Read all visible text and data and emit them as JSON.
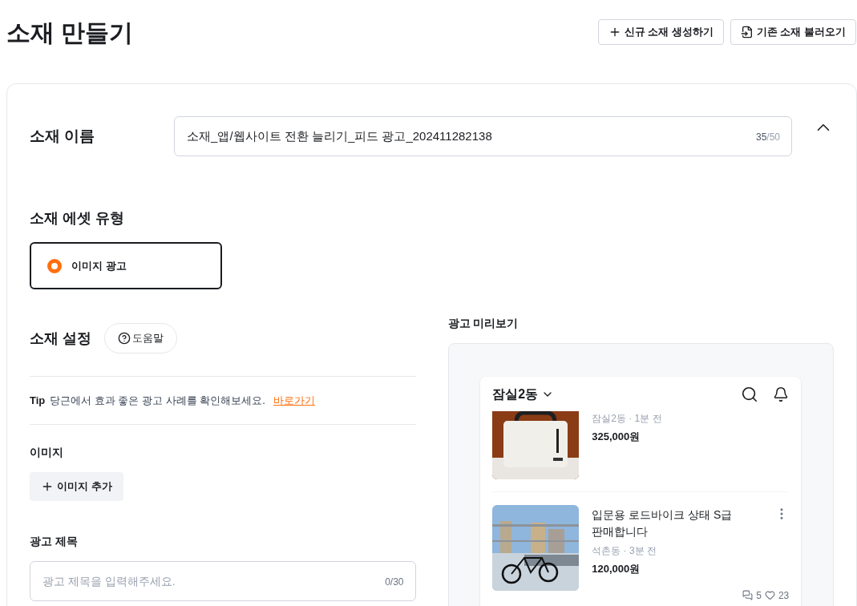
{
  "page": {
    "title": "소재 만들기",
    "actions": [
      {
        "kind": "new",
        "label": "신규 소재 생성하기"
      },
      {
        "kind": "load",
        "label": "기존 소재 불러오기"
      }
    ]
  },
  "name_section": {
    "label": "소재 이름",
    "value": "소재_앱/웹사이트 전환 늘리기_피드 광고_202411282138",
    "count": "35",
    "max": "/50",
    "expanded": true
  },
  "asset_type": {
    "label": "소재 에셋 유형",
    "options": [
      {
        "label": "이미지 광고",
        "selected": true
      }
    ]
  },
  "settings": {
    "label": "소재 설정",
    "help": "도움말",
    "tip_label": "Tip",
    "tip": "당근에서 효과 좋은 광고 사례를 확인해보세요.",
    "tip_link": "바로가기",
    "image_label": "이미지",
    "add_image": "이미지 추가",
    "title_label": "광고 제목",
    "title_placeholder": "광고 제목을 입력해주세요.",
    "title_count": "0/30"
  },
  "preview": {
    "label": "광고 미리보기",
    "location": "잠실2동",
    "items": [
      {
        "kind": "cut",
        "meta": "잠실2동 · 1분 전",
        "price": "325,000원"
      },
      {
        "kind": "full",
        "title": "입문용 로드바이크 상태 S급 판매합니다",
        "meta": "석촌동 · 3분 전",
        "price": "120,000원",
        "comments": "5",
        "likes": "23"
      }
    ]
  }
}
